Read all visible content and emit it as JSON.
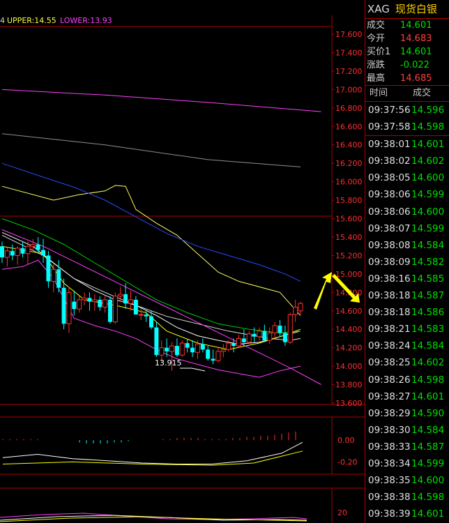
{
  "chart_data": {
    "type": "candlestick",
    "indicators": {
      "prefix": "4",
      "upper_label": "UPPER:14.55",
      "lower_label": "LOWER:13.93"
    },
    "y_ticks": [
      "17.600",
      "17.400",
      "17.200",
      "17.000",
      "16.800",
      "16.600",
      "16.400",
      "16.200",
      "16.000",
      "15.800",
      "15.600",
      "15.400",
      "15.200",
      "15.000",
      "14.800",
      "14.600",
      "14.400",
      "14.200",
      "14.000",
      "13.800",
      "13.600"
    ],
    "ylim": [
      13.6,
      17.6
    ],
    "low_annotation": "13.915",
    "candles": [
      [
        15.3,
        15.35,
        15.12,
        15.18
      ],
      [
        15.18,
        15.28,
        15.08,
        15.25
      ],
      [
        15.25,
        15.32,
        15.15,
        15.2
      ],
      [
        15.2,
        15.3,
        15.1,
        15.28
      ],
      [
        15.28,
        15.35,
        15.18,
        15.22
      ],
      [
        15.22,
        15.35,
        15.1,
        15.3
      ],
      [
        15.3,
        15.38,
        15.25,
        15.32
      ],
      [
        15.32,
        15.4,
        15.22,
        15.26
      ],
      [
        15.26,
        15.38,
        15.12,
        15.2
      ],
      [
        15.2,
        15.25,
        14.85,
        14.92
      ],
      [
        14.92,
        15.1,
        14.8,
        15.05
      ],
      [
        15.05,
        15.15,
        14.8,
        14.85
      ],
      [
        14.85,
        14.95,
        14.4,
        14.46
      ],
      [
        14.46,
        14.86,
        14.36,
        14.8
      ],
      [
        14.7,
        14.82,
        14.55,
        14.62
      ],
      [
        14.62,
        14.76,
        14.58,
        14.72
      ],
      [
        14.72,
        14.8,
        14.66,
        14.74
      ],
      [
        14.74,
        14.8,
        14.6,
        14.7
      ],
      [
        14.7,
        14.78,
        14.6,
        14.72
      ],
      [
        14.72,
        14.76,
        14.6,
        14.64
      ],
      [
        14.64,
        14.76,
        14.58,
        14.72
      ],
      [
        14.72,
        14.76,
        14.46,
        14.48
      ],
      [
        14.48,
        14.8,
        14.46,
        14.76
      ],
      [
        14.76,
        14.86,
        14.7,
        14.78
      ],
      [
        14.78,
        14.9,
        14.62,
        14.68
      ],
      [
        14.68,
        14.82,
        14.6,
        14.72
      ],
      [
        14.72,
        14.76,
        14.58,
        14.56
      ],
      [
        14.56,
        14.62,
        14.5,
        14.56
      ],
      [
        14.56,
        14.6,
        14.48,
        14.54
      ],
      [
        14.54,
        14.6,
        14.4,
        14.42
      ],
      [
        14.42,
        14.48,
        14.1,
        14.12
      ],
      [
        14.12,
        14.28,
        14.05,
        14.2
      ],
      [
        14.2,
        14.3,
        14.1,
        14.16
      ],
      [
        14.16,
        14.26,
        13.95,
        14.22
      ],
      [
        14.22,
        14.3,
        14.1,
        14.12
      ],
      [
        14.12,
        14.28,
        14.1,
        14.25
      ],
      [
        14.25,
        14.3,
        14.15,
        14.2
      ],
      [
        14.2,
        14.28,
        14.1,
        14.15
      ],
      [
        14.15,
        14.28,
        14.08,
        14.24
      ],
      [
        14.24,
        14.3,
        14.15,
        14.18
      ],
      [
        14.18,
        14.22,
        14.06,
        14.08
      ],
      [
        14.08,
        14.18,
        14.02,
        14.06
      ],
      [
        14.06,
        14.2,
        14.04,
        14.16
      ],
      [
        14.16,
        14.24,
        14.1,
        14.18
      ],
      [
        14.18,
        14.28,
        14.16,
        14.25
      ],
      [
        14.25,
        14.3,
        14.15,
        14.22
      ],
      [
        14.22,
        14.34,
        14.2,
        14.3
      ],
      [
        14.3,
        14.4,
        14.22,
        14.26
      ],
      [
        14.26,
        14.38,
        14.24,
        14.35
      ],
      [
        14.35,
        14.42,
        14.26,
        14.32
      ],
      [
        14.32,
        14.42,
        14.28,
        14.38
      ],
      [
        14.38,
        14.45,
        14.26,
        14.28
      ],
      [
        14.28,
        14.42,
        14.24,
        14.36
      ],
      [
        14.36,
        14.48,
        14.3,
        14.44
      ],
      [
        14.44,
        14.5,
        14.32,
        14.36
      ],
      [
        14.36,
        14.44,
        14.22,
        14.26
      ],
      [
        14.26,
        14.58,
        14.24,
        14.56
      ],
      [
        14.56,
        14.72,
        14.48,
        14.64
      ],
      [
        14.6,
        14.7,
        14.56,
        14.68
      ]
    ],
    "lines": {
      "upper_band": [
        [
          0,
          15.95
        ],
        [
          10,
          15.8
        ],
        [
          15,
          15.86
        ],
        [
          20,
          15.9
        ],
        [
          22,
          15.96
        ],
        [
          24,
          15.95
        ],
        [
          26,
          15.7
        ],
        [
          30,
          15.55
        ],
        [
          34,
          15.42
        ],
        [
          38,
          15.22
        ],
        [
          42,
          15.02
        ],
        [
          46,
          14.92
        ],
        [
          50,
          14.86
        ],
        [
          54,
          14.8
        ],
        [
          58,
          14.55
        ]
      ],
      "mid_band": [
        [
          0,
          15.45
        ],
        [
          6,
          15.3
        ],
        [
          10,
          15.12
        ],
        [
          14,
          14.95
        ],
        [
          18,
          14.82
        ],
        [
          22,
          14.72
        ],
        [
          26,
          14.66
        ],
        [
          30,
          14.55
        ],
        [
          34,
          14.42
        ],
        [
          38,
          14.33
        ],
        [
          42,
          14.28
        ],
        [
          46,
          14.24
        ],
        [
          50,
          14.26
        ],
        [
          54,
          14.32
        ],
        [
          58,
          14.38
        ]
      ],
      "lower_band": [
        [
          0,
          15.05
        ],
        [
          4,
          15.08
        ],
        [
          7,
          15.15
        ],
        [
          10,
          14.95
        ],
        [
          14,
          14.52
        ],
        [
          18,
          14.44
        ],
        [
          22,
          14.38
        ],
        [
          26,
          14.3
        ],
        [
          30,
          14.18
        ],
        [
          34,
          14.08
        ],
        [
          38,
          14.02
        ],
        [
          42,
          13.96
        ],
        [
          46,
          13.92
        ],
        [
          50,
          13.88
        ],
        [
          54,
          13.95
        ],
        [
          58,
          14.0
        ]
      ],
      "ma_green": [
        [
          0,
          15.6
        ],
        [
          6,
          15.48
        ],
        [
          12,
          15.32
        ],
        [
          18,
          15.12
        ],
        [
          24,
          14.92
        ],
        [
          30,
          14.72
        ],
        [
          36,
          14.58
        ],
        [
          42,
          14.46
        ],
        [
          48,
          14.4
        ],
        [
          54,
          14.36
        ],
        [
          58,
          14.38
        ]
      ],
      "ma_blue": [
        [
          0,
          16.2
        ],
        [
          8,
          16.05
        ],
        [
          14,
          15.94
        ],
        [
          20,
          15.8
        ],
        [
          26,
          15.62
        ],
        [
          32,
          15.44
        ],
        [
          38,
          15.3
        ],
        [
          44,
          15.2
        ],
        [
          50,
          15.1
        ],
        [
          55,
          15.0
        ],
        [
          58,
          14.92
        ]
      ],
      "ma_white": [
        [
          0,
          15.42
        ],
        [
          8,
          15.2
        ],
        [
          14,
          14.95
        ],
        [
          20,
          14.8
        ],
        [
          26,
          14.66
        ],
        [
          32,
          14.54
        ],
        [
          38,
          14.46
        ],
        [
          44,
          14.38
        ],
        [
          48,
          14.34
        ],
        [
          52,
          14.3
        ],
        [
          56,
          14.28
        ],
        [
          58,
          14.3
        ]
      ],
      "ma_yellow_short": [
        [
          0,
          15.3
        ],
        [
          8,
          15.22
        ],
        [
          12,
          14.9
        ],
        [
          16,
          14.72
        ],
        [
          22,
          14.66
        ],
        [
          28,
          14.58
        ],
        [
          32,
          14.38
        ],
        [
          38,
          14.25
        ],
        [
          44,
          14.18
        ],
        [
          50,
          14.25
        ],
        [
          54,
          14.32
        ],
        [
          58,
          14.4
        ]
      ],
      "diag_magenta": [
        [
          0,
          15.48
        ],
        [
          8,
          15.3
        ],
        [
          16,
          15.08
        ],
        [
          24,
          14.86
        ],
        [
          32,
          14.64
        ],
        [
          40,
          14.42
        ],
        [
          48,
          14.2
        ],
        [
          56,
          13.98
        ],
        [
          62,
          13.8
        ]
      ],
      "ma_magenta_long": [
        [
          0,
          17.0
        ],
        [
          20,
          16.94
        ],
        [
          40,
          16.86
        ],
        [
          62,
          16.76
        ]
      ],
      "ma_gray_long": [
        [
          0,
          16.52
        ],
        [
          20,
          16.4
        ],
        [
          40,
          16.24
        ],
        [
          58,
          16.16
        ]
      ]
    },
    "macd": {
      "y_ticks": [
        "0.00",
        "-0.20"
      ],
      "ylim": [
        -0.3,
        0.2
      ],
      "hist": [
        0.01,
        0.01,
        0.01,
        0.01,
        0.01,
        0.01,
        0.0,
        0.0,
        0.0,
        0.0,
        0.0,
        -0.02,
        -0.03,
        -0.03,
        -0.03,
        -0.03,
        -0.02,
        -0.02,
        -0.01,
        0.0,
        0.0,
        0.0,
        0.0,
        0.01,
        0.01,
        0.02,
        0.02,
        0.02,
        0.02,
        0.01,
        0.01,
        0.01,
        0.01,
        0.02,
        0.02,
        0.03,
        0.03,
        0.04,
        0.04,
        0.05,
        0.06,
        0.07,
        0.08
      ],
      "dif": [
        [
          0,
          -0.16
        ],
        [
          5,
          -0.13
        ],
        [
          10,
          -0.17
        ],
        [
          15,
          -0.19
        ],
        [
          20,
          -0.21
        ],
        [
          25,
          -0.22
        ],
        [
          30,
          -0.22
        ],
        [
          35,
          -0.19
        ],
        [
          40,
          -0.12
        ],
        [
          43,
          -0.02
        ]
      ],
      "dea": [
        [
          0,
          -0.22
        ],
        [
          10,
          -0.2
        ],
        [
          20,
          -0.22
        ],
        [
          30,
          -0.23
        ],
        [
          36,
          -0.21
        ],
        [
          43,
          -0.1
        ]
      ]
    },
    "kdj": {
      "y_ticks": [
        "20"
      ],
      "ylim": [
        0,
        100
      ]
    }
  },
  "panel": {
    "symbol": "XAG",
    "name": "现货白银",
    "quotes": [
      {
        "label": "成交",
        "value": "14.601",
        "color": "#00e000"
      },
      {
        "label": "今开",
        "value": "14.683",
        "color": "#ff4040"
      },
      {
        "label": "买价1",
        "value": "14.601",
        "color": "#00e000"
      },
      {
        "label": "涨跌",
        "value": "-0.022",
        "color": "#00e000"
      },
      {
        "label": "最高",
        "value": "14.685",
        "color": "#ff4040"
      }
    ],
    "col_time": "时间",
    "col_price": "成交",
    "ticks": [
      {
        "t": "09:37:56",
        "p": "14.596"
      },
      {
        "t": "09:37:58",
        "p": "14.598"
      },
      {
        "t": "09:38:01",
        "p": "14.601"
      },
      {
        "t": "09:38:02",
        "p": "14.602"
      },
      {
        "t": "09:38:05",
        "p": "14.600"
      },
      {
        "t": "09:38:06",
        "p": "14.599"
      },
      {
        "t": "09:38:06",
        "p": "14.600"
      },
      {
        "t": "09:38:07",
        "p": "14.599"
      },
      {
        "t": "09:38:08",
        "p": "14.584"
      },
      {
        "t": "09:38:09",
        "p": "14.582"
      },
      {
        "t": "09:38:16",
        "p": "14.585"
      },
      {
        "t": "09:38:18",
        "p": "14.587"
      },
      {
        "t": "09:38:18",
        "p": "14.586"
      },
      {
        "t": "09:38:21",
        "p": "14.583"
      },
      {
        "t": "09:38:24",
        "p": "14.584"
      },
      {
        "t": "09:38:25",
        "p": "14.602"
      },
      {
        "t": "09:38:26",
        "p": "14.598"
      },
      {
        "t": "09:38:27",
        "p": "14.601"
      },
      {
        "t": "09:38:29",
        "p": "14.590"
      },
      {
        "t": "09:38:30",
        "p": "14.584"
      },
      {
        "t": "09:38:33",
        "p": "14.587"
      },
      {
        "t": "09:38:34",
        "p": "14.599"
      },
      {
        "t": "09:38:35",
        "p": "14.600"
      },
      {
        "t": "09:38:38",
        "p": "14.598"
      },
      {
        "t": "09:38:39",
        "p": "14.601"
      }
    ]
  }
}
